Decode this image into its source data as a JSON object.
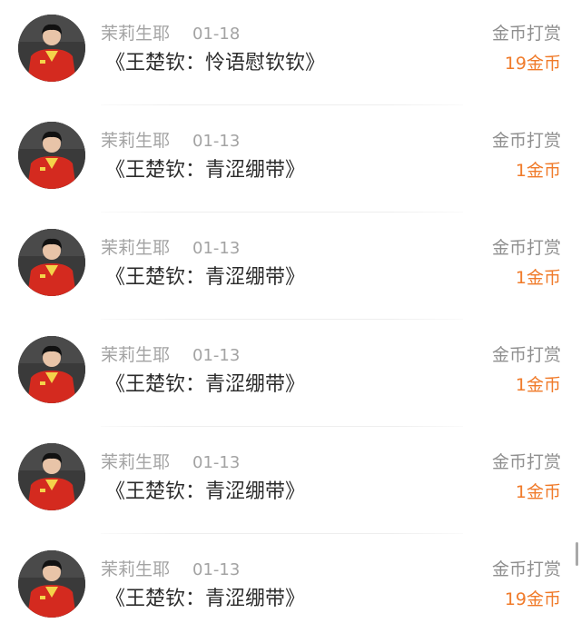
{
  "reward_label": "金币打赏",
  "items": [
    {
      "user": "茉莉生耶",
      "date": "01-18",
      "title": "《王楚钦：怜语慰钦钦》",
      "amount": "19金币"
    },
    {
      "user": "茉莉生耶",
      "date": "01-13",
      "title": "《王楚钦：青涩绷带》",
      "amount": "1金币"
    },
    {
      "user": "茉莉生耶",
      "date": "01-13",
      "title": "《王楚钦：青涩绷带》",
      "amount": "1金币"
    },
    {
      "user": "茉莉生耶",
      "date": "01-13",
      "title": "《王楚钦：青涩绷带》",
      "amount": "1金币"
    },
    {
      "user": "茉莉生耶",
      "date": "01-13",
      "title": "《王楚钦：青涩绷带》",
      "amount": "1金币"
    },
    {
      "user": "茉莉生耶",
      "date": "01-13",
      "title": "《王楚钦：青涩绷带》",
      "amount": "19金币"
    }
  ],
  "colors": {
    "meta": "#a3a3a3",
    "title": "#2b2b2b",
    "label": "#8f8f8f",
    "accent": "#f07a29"
  },
  "avatar_icon": "person-photo-icon"
}
